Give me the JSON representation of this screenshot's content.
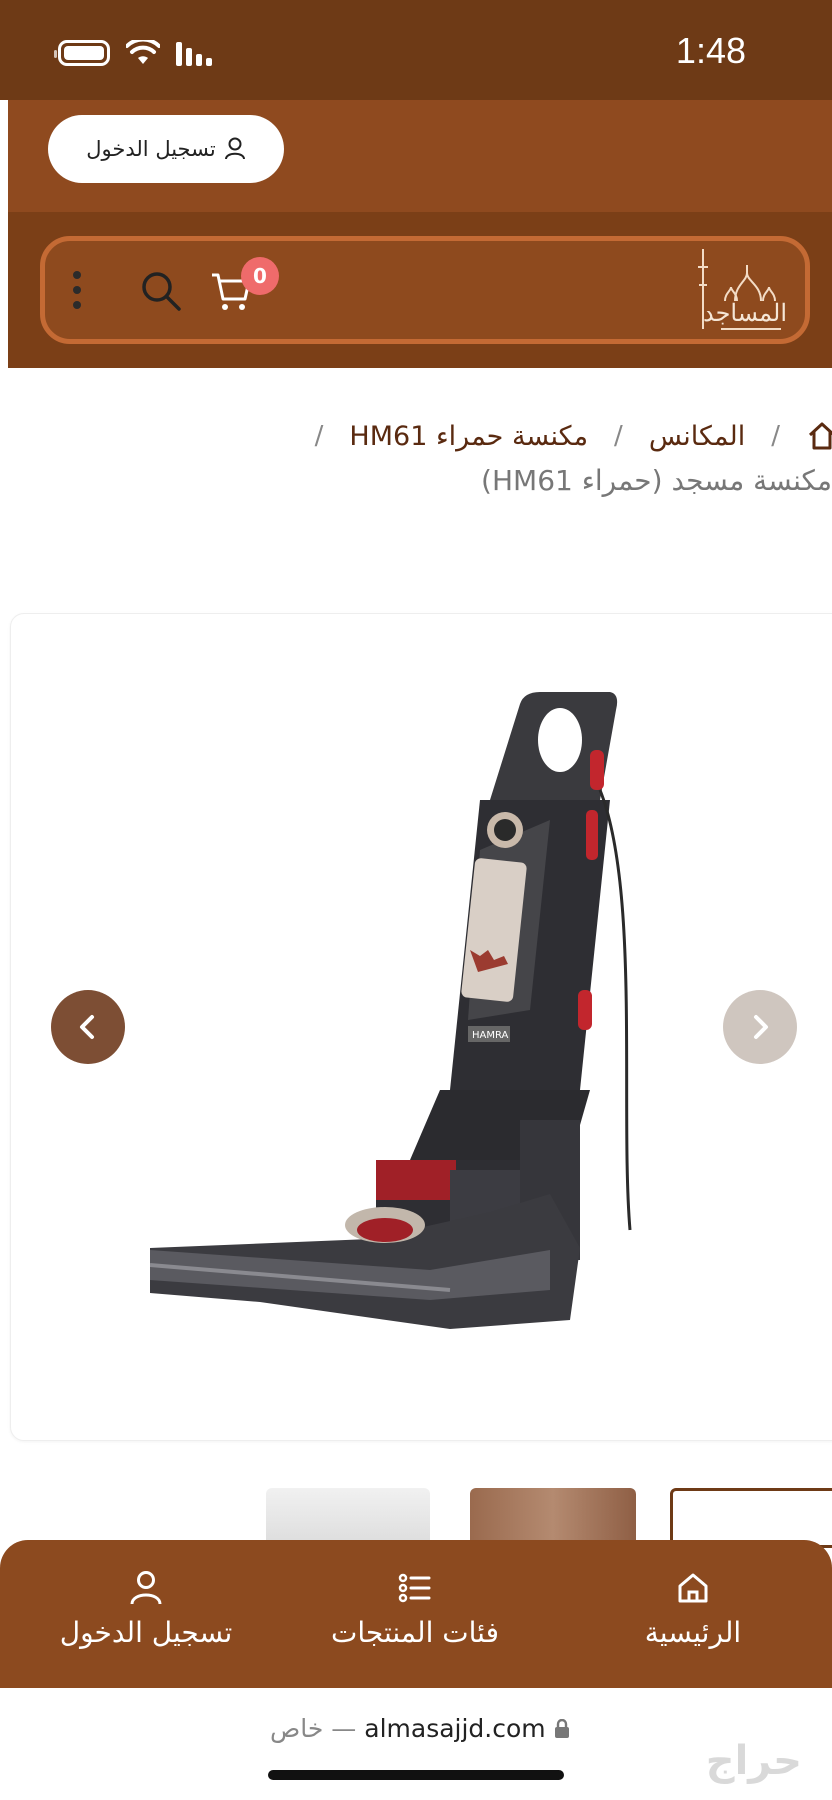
{
  "status_bar": {
    "time": "1:48"
  },
  "top": {
    "login_label": "تسجيل الدخول"
  },
  "header": {
    "logo_text": "المساجد",
    "cart_count": "0"
  },
  "breadcrumb": {
    "items": [
      "المكانس",
      "مكنسة حمراء HM61"
    ],
    "separator": "/"
  },
  "product": {
    "title": "مكنسة مسجد (حمراء HM61)",
    "brand_mark": "HAMRA"
  },
  "bottom_nav": {
    "items": [
      {
        "label": "الرئيسية",
        "icon": "home-icon"
      },
      {
        "label": "فئات المنتجات",
        "icon": "list-icon"
      },
      {
        "label": "تسجيل الدخول",
        "icon": "user-icon"
      }
    ]
  },
  "browser": {
    "url": "almasajjd.com",
    "private_label": "خاص —"
  },
  "watermark": "حراج"
}
